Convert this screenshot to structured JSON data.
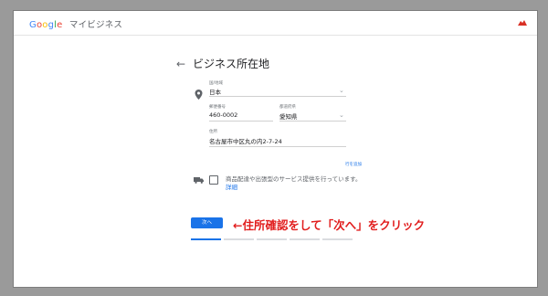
{
  "header": {
    "brand": "Google",
    "app_name": "マイビジネス"
  },
  "page": {
    "title": "ビジネス所在地",
    "back_icon": "arrow-left-icon"
  },
  "form": {
    "country": {
      "label": "国/地域",
      "value": "日本"
    },
    "postal_code": {
      "label": "郵便番号",
      "value": "460-0002"
    },
    "prefecture": {
      "label": "都道府県",
      "value": "愛知県"
    },
    "address": {
      "label": "住所",
      "value": "名古屋市中区丸の内2-7-24"
    },
    "add_line_link": "行を追加"
  },
  "service": {
    "text": "商品配達や出張型のサービス提供を行っています。",
    "details_link": "詳細",
    "checked": false
  },
  "actions": {
    "next_button": "次へ"
  },
  "annotation": {
    "text": "←住所確認をして「次へ」をクリック"
  },
  "progress": {
    "steps_total": 5,
    "current_step": 1
  },
  "colors": {
    "accent": "#1a73e8",
    "annotation": "#e11d1d"
  }
}
